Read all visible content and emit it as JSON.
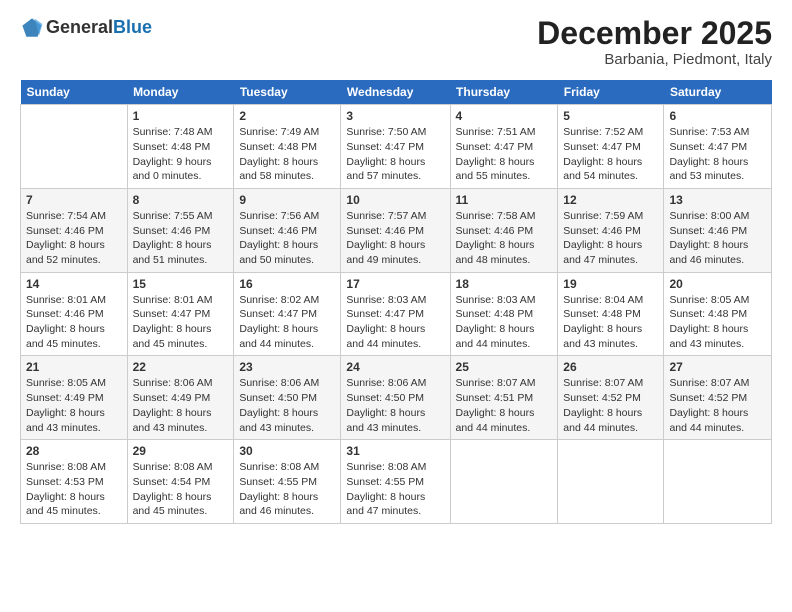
{
  "logo": {
    "general": "General",
    "blue": "Blue"
  },
  "title": "December 2025",
  "location": "Barbania, Piedmont, Italy",
  "days_header": [
    "Sunday",
    "Monday",
    "Tuesday",
    "Wednesday",
    "Thursday",
    "Friday",
    "Saturday"
  ],
  "weeks": [
    [
      {
        "num": "",
        "info": ""
      },
      {
        "num": "1",
        "info": "Sunrise: 7:48 AM\nSunset: 4:48 PM\nDaylight: 9 hours\nand 0 minutes."
      },
      {
        "num": "2",
        "info": "Sunrise: 7:49 AM\nSunset: 4:48 PM\nDaylight: 8 hours\nand 58 minutes."
      },
      {
        "num": "3",
        "info": "Sunrise: 7:50 AM\nSunset: 4:47 PM\nDaylight: 8 hours\nand 57 minutes."
      },
      {
        "num": "4",
        "info": "Sunrise: 7:51 AM\nSunset: 4:47 PM\nDaylight: 8 hours\nand 55 minutes."
      },
      {
        "num": "5",
        "info": "Sunrise: 7:52 AM\nSunset: 4:47 PM\nDaylight: 8 hours\nand 54 minutes."
      },
      {
        "num": "6",
        "info": "Sunrise: 7:53 AM\nSunset: 4:47 PM\nDaylight: 8 hours\nand 53 minutes."
      }
    ],
    [
      {
        "num": "7",
        "info": "Sunrise: 7:54 AM\nSunset: 4:46 PM\nDaylight: 8 hours\nand 52 minutes."
      },
      {
        "num": "8",
        "info": "Sunrise: 7:55 AM\nSunset: 4:46 PM\nDaylight: 8 hours\nand 51 minutes."
      },
      {
        "num": "9",
        "info": "Sunrise: 7:56 AM\nSunset: 4:46 PM\nDaylight: 8 hours\nand 50 minutes."
      },
      {
        "num": "10",
        "info": "Sunrise: 7:57 AM\nSunset: 4:46 PM\nDaylight: 8 hours\nand 49 minutes."
      },
      {
        "num": "11",
        "info": "Sunrise: 7:58 AM\nSunset: 4:46 PM\nDaylight: 8 hours\nand 48 minutes."
      },
      {
        "num": "12",
        "info": "Sunrise: 7:59 AM\nSunset: 4:46 PM\nDaylight: 8 hours\nand 47 minutes."
      },
      {
        "num": "13",
        "info": "Sunrise: 8:00 AM\nSunset: 4:46 PM\nDaylight: 8 hours\nand 46 minutes."
      }
    ],
    [
      {
        "num": "14",
        "info": "Sunrise: 8:01 AM\nSunset: 4:46 PM\nDaylight: 8 hours\nand 45 minutes."
      },
      {
        "num": "15",
        "info": "Sunrise: 8:01 AM\nSunset: 4:47 PM\nDaylight: 8 hours\nand 45 minutes."
      },
      {
        "num": "16",
        "info": "Sunrise: 8:02 AM\nSunset: 4:47 PM\nDaylight: 8 hours\nand 44 minutes."
      },
      {
        "num": "17",
        "info": "Sunrise: 8:03 AM\nSunset: 4:47 PM\nDaylight: 8 hours\nand 44 minutes."
      },
      {
        "num": "18",
        "info": "Sunrise: 8:03 AM\nSunset: 4:48 PM\nDaylight: 8 hours\nand 44 minutes."
      },
      {
        "num": "19",
        "info": "Sunrise: 8:04 AM\nSunset: 4:48 PM\nDaylight: 8 hours\nand 43 minutes."
      },
      {
        "num": "20",
        "info": "Sunrise: 8:05 AM\nSunset: 4:48 PM\nDaylight: 8 hours\nand 43 minutes."
      }
    ],
    [
      {
        "num": "21",
        "info": "Sunrise: 8:05 AM\nSunset: 4:49 PM\nDaylight: 8 hours\nand 43 minutes."
      },
      {
        "num": "22",
        "info": "Sunrise: 8:06 AM\nSunset: 4:49 PM\nDaylight: 8 hours\nand 43 minutes."
      },
      {
        "num": "23",
        "info": "Sunrise: 8:06 AM\nSunset: 4:50 PM\nDaylight: 8 hours\nand 43 minutes."
      },
      {
        "num": "24",
        "info": "Sunrise: 8:06 AM\nSunset: 4:50 PM\nDaylight: 8 hours\nand 43 minutes."
      },
      {
        "num": "25",
        "info": "Sunrise: 8:07 AM\nSunset: 4:51 PM\nDaylight: 8 hours\nand 44 minutes."
      },
      {
        "num": "26",
        "info": "Sunrise: 8:07 AM\nSunset: 4:52 PM\nDaylight: 8 hours\nand 44 minutes."
      },
      {
        "num": "27",
        "info": "Sunrise: 8:07 AM\nSunset: 4:52 PM\nDaylight: 8 hours\nand 44 minutes."
      }
    ],
    [
      {
        "num": "28",
        "info": "Sunrise: 8:08 AM\nSunset: 4:53 PM\nDaylight: 8 hours\nand 45 minutes."
      },
      {
        "num": "29",
        "info": "Sunrise: 8:08 AM\nSunset: 4:54 PM\nDaylight: 8 hours\nand 45 minutes."
      },
      {
        "num": "30",
        "info": "Sunrise: 8:08 AM\nSunset: 4:55 PM\nDaylight: 8 hours\nand 46 minutes."
      },
      {
        "num": "31",
        "info": "Sunrise: 8:08 AM\nSunset: 4:55 PM\nDaylight: 8 hours\nand 47 minutes."
      },
      {
        "num": "",
        "info": ""
      },
      {
        "num": "",
        "info": ""
      },
      {
        "num": "",
        "info": ""
      }
    ]
  ]
}
